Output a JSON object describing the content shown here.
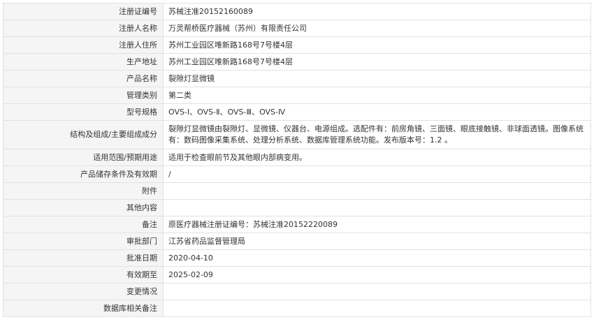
{
  "rows": [
    {
      "label": "注册证编号",
      "value": "苏械注准20152160089"
    },
    {
      "label": "注册人名称",
      "value": "万灵帮桥医疗器械（苏州）有限责任公司"
    },
    {
      "label": "注册人住所",
      "value": "苏州工业园区唯新路168号7号楼4层"
    },
    {
      "label": "生产地址",
      "value": "苏州工业园区唯新路168号7号楼4层"
    },
    {
      "label": "产品名称",
      "value": "裂隙灯显微镜"
    },
    {
      "label": "管理类别",
      "value": "第二类"
    },
    {
      "label": "型号规格",
      "value": "OVS-Ⅰ、OVS-Ⅱ、OVS-Ⅲ、OVS-Ⅳ"
    },
    {
      "label": "结构及组成/主要组成成分",
      "value": "裂隙灯显微镜由裂隙灯、显微镜、仪器台、电源组成。选配件有：前房角镜、三面镜、眼底接触镜、非球面透镜。图像系统有：数码图像采集系统、处理分析系统、数据库管理系统功能。发布版本号：1.2 。"
    },
    {
      "label": "适用范围/预期用途",
      "value": "适用于检查眼前节及其他眼内部病变用。"
    },
    {
      "label": "产品储存条件及有效期",
      "value": "/"
    },
    {
      "label": "附件",
      "value": ""
    },
    {
      "label": "其他内容",
      "value": ""
    },
    {
      "label": "备注",
      "value": "原医疗器械注册证编号：苏械注准20152220089"
    },
    {
      "label": "审批部门",
      "value": "江苏省药品监督管理局"
    },
    {
      "label": "批准日期",
      "value": "2020-04-10"
    },
    {
      "label": "有效期至",
      "value": "2025-02-09"
    },
    {
      "label": "变更情况",
      "value": ""
    },
    {
      "label": "数据库相关备注",
      "value": ""
    }
  ]
}
